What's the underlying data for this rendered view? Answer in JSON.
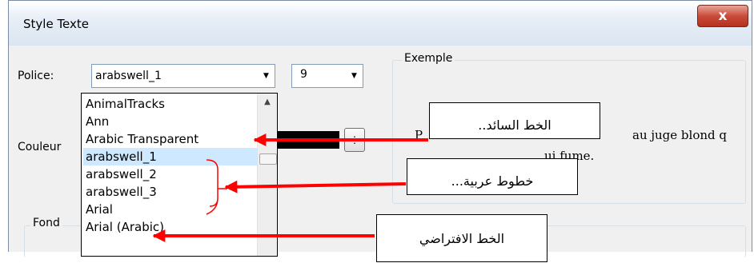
{
  "window": {
    "title": "Style Texte",
    "close_label": "x"
  },
  "font": {
    "label": "Police:",
    "value": "arabswell_1",
    "size_value": "9"
  },
  "color": {
    "label": "Couleur"
  },
  "background_group": {
    "label": "Fond"
  },
  "example_group": {
    "label": "Exemple",
    "preview_line1": "au juge blond q",
    "preview_line2": "ui fume.",
    "preview_cut": "P"
  },
  "font_list": {
    "items": [
      "AnimalTracks",
      "Ann",
      "Arabic Transparent",
      "arabswell_1",
      "arabswell_2",
      "arabswell_3",
      "Arial",
      "Arial (Arabic)"
    ],
    "selected_index": 3
  },
  "annotations": {
    "current_font": "الخط السائد..",
    "arabic_fonts": "خطوط عربية...",
    "default_font": "الخط الافتراضي"
  },
  "colors": {
    "arrow": "#ff0000",
    "bracket": "#ff0000",
    "selection": "#cde8ff"
  }
}
